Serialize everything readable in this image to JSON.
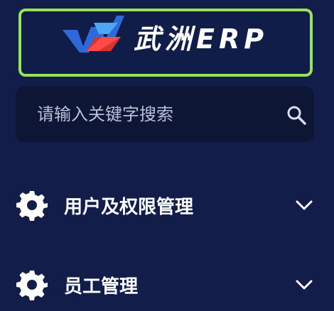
{
  "logo": {
    "text": "武洲ERP",
    "accent_color": "#97e25a"
  },
  "search": {
    "placeholder": "请输入关键字搜索",
    "value": "",
    "icon": "search-icon"
  },
  "menu": {
    "items": [
      {
        "label": "用户及权限管理",
        "icon": "gear-icon",
        "expand_icon": "chevron-down-icon"
      },
      {
        "label": "员工管理",
        "icon": "gear-icon",
        "expand_icon": "chevron-down-icon"
      }
    ]
  },
  "colors": {
    "background": "#121d4a",
    "search_background": "#0d1634",
    "text": "#ffffff",
    "logo_border": "#97e25a"
  }
}
